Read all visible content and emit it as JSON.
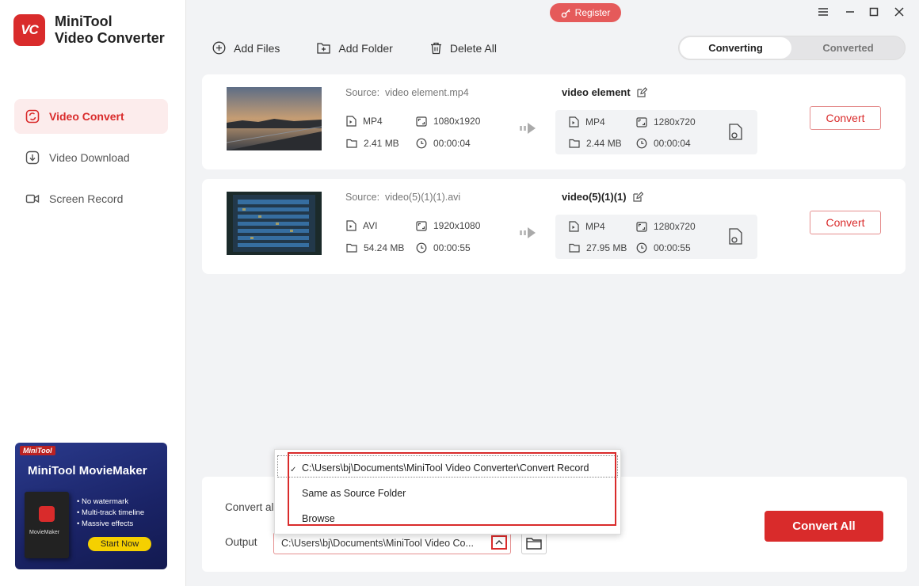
{
  "app": {
    "name_line1": "MiniTool",
    "name_line2": "Video Converter",
    "logo_text": "VC"
  },
  "window": {
    "register_label": "Register"
  },
  "sidebar": {
    "items": [
      {
        "label": "Video Convert",
        "active": true,
        "icon": "convert-icon"
      },
      {
        "label": "Video Download",
        "active": false,
        "icon": "download-icon"
      },
      {
        "label": "Screen Record",
        "active": false,
        "icon": "camera-icon"
      }
    ]
  },
  "ad": {
    "brand": "MiniTool",
    "title": "MiniTool MovieMaker",
    "box_label": "MovieMaker",
    "features": [
      "• No watermark",
      "• Multi-track timeline",
      "• Massive effects"
    ],
    "button": "Start Now"
  },
  "toolbar": {
    "add_files": "Add Files",
    "add_folder": "Add Folder",
    "delete_all": "Delete All"
  },
  "tabs": {
    "converting": "Converting",
    "converted": "Converted"
  },
  "files": [
    {
      "source_label": "Source:",
      "source_name": "video element.mp4",
      "format": "MP4",
      "resolution": "1080x1920",
      "size": "2.41 MB",
      "duration": "00:00:04",
      "output_name": "video element",
      "out_format": "MP4",
      "out_resolution": "1280x720",
      "out_size": "2.44 MB",
      "out_duration": "00:00:04",
      "convert_label": "Convert"
    },
    {
      "source_label": "Source:",
      "source_name": "video(5)(1)(1).avi",
      "format": "AVI",
      "resolution": "1920x1080",
      "size": "54.24 MB",
      "duration": "00:00:55",
      "output_name": "video(5)(1)(1)",
      "out_format": "MP4",
      "out_resolution": "1280x720",
      "out_size": "27.95 MB",
      "out_duration": "00:00:55",
      "convert_label": "Convert"
    }
  ],
  "bottom": {
    "convert_all_to": "Convert all",
    "output_label": "Output",
    "output_path": "C:\\Users\\bj\\Documents\\MiniTool Video Co...",
    "convert_all_button": "Convert All"
  },
  "dropdown": {
    "check": "✓",
    "options": [
      "C:\\Users\\bj\\Documents\\MiniTool Video Converter\\Convert Record",
      "Same as Source Folder",
      "Browse"
    ]
  },
  "colors": {
    "accent": "#d92b2b"
  }
}
